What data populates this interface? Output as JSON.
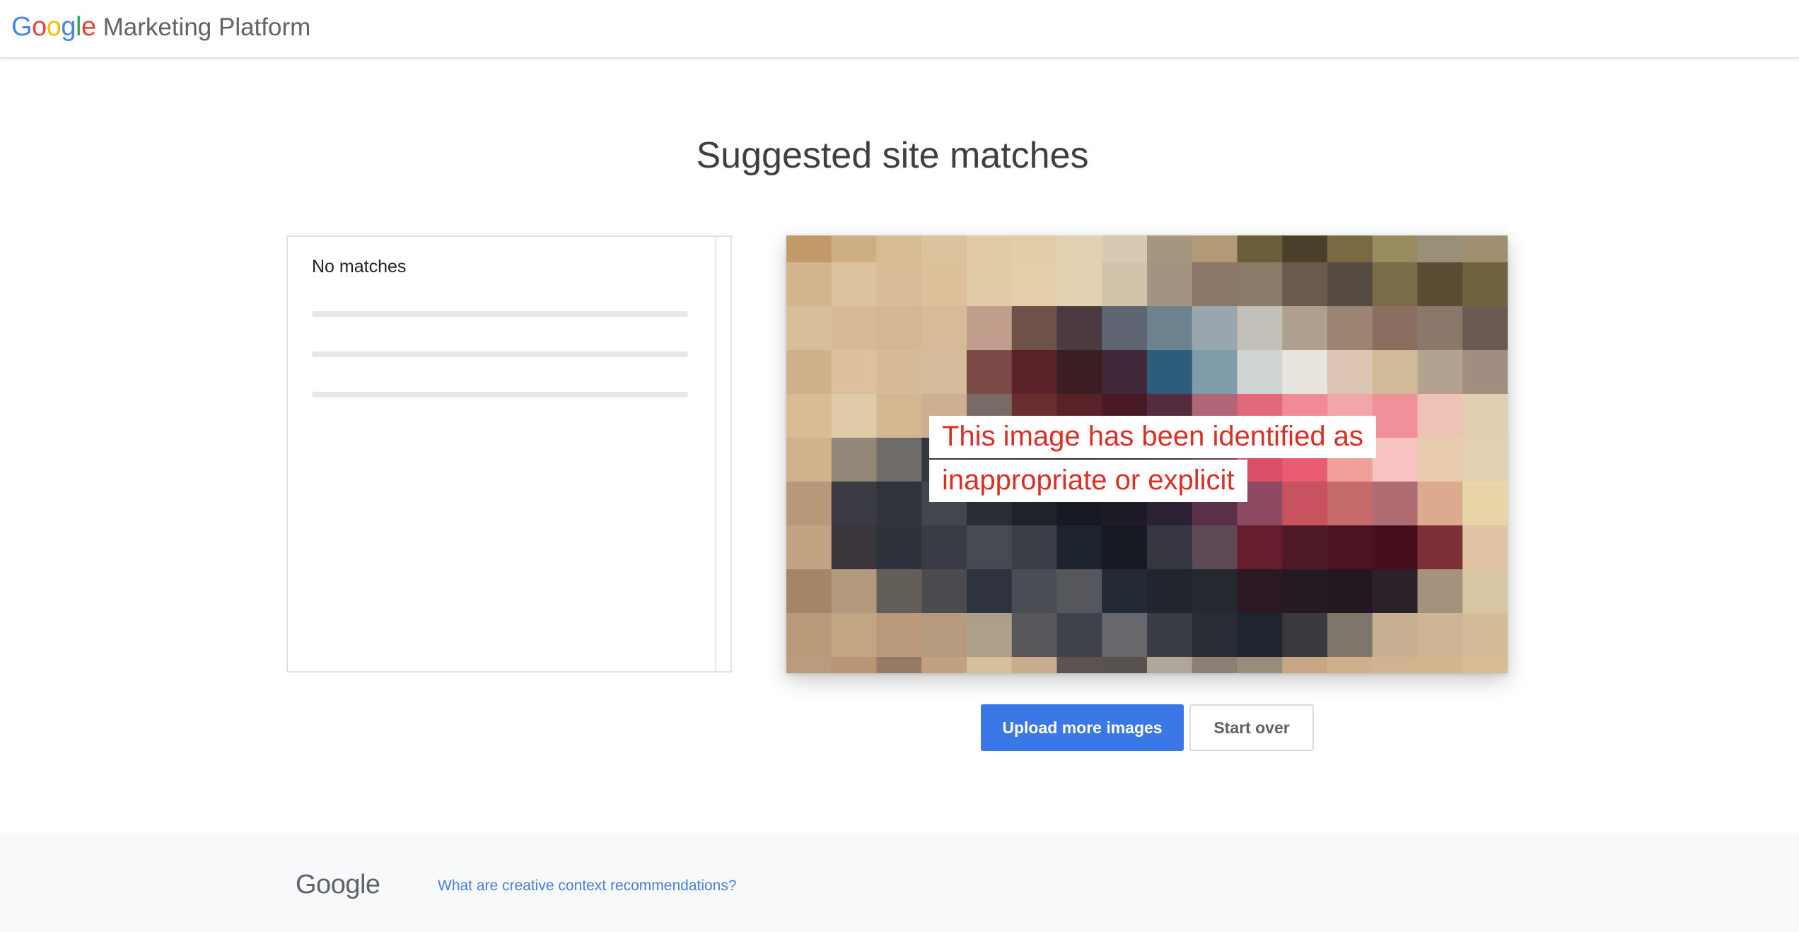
{
  "header": {
    "logo_text": "Google",
    "product_name": "Marketing Platform"
  },
  "main": {
    "title": "Suggested site matches",
    "matches_panel": {
      "no_matches_label": "No matches"
    },
    "image_preview": {
      "warning_line1": "This image has been identified as",
      "warning_line2": "inappropriate or explicit"
    },
    "buttons": {
      "upload_label": "Upload more images",
      "start_over_label": "Start over"
    }
  },
  "footer": {
    "logo_text": "Google",
    "help_link": "What are creative context recommendations?"
  },
  "colors": {
    "accent": "#3b78e7",
    "warning_text": "#d93025",
    "link": "#4a7fe0"
  },
  "icons": [
    "google-logo",
    "google-footer-logo"
  ]
}
